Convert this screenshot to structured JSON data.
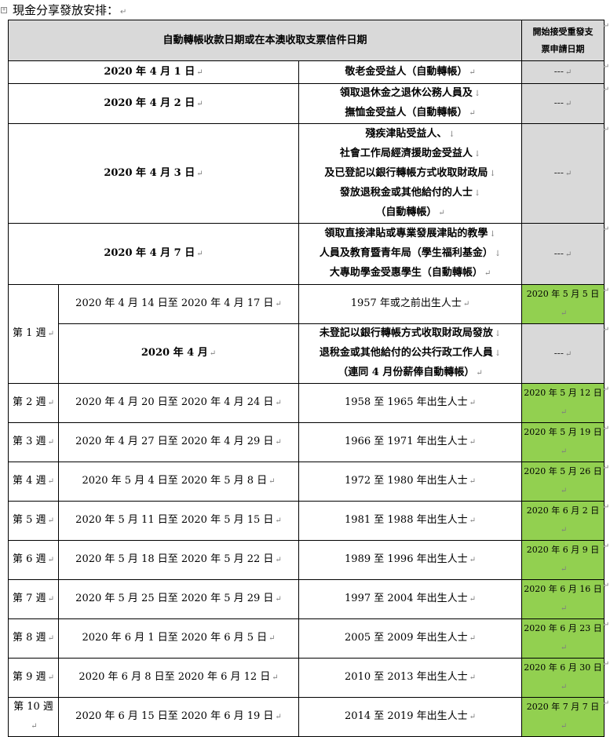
{
  "heading": "現金分享發放安排：",
  "header": {
    "main": "自動轉帳收款日期或在本澳收取支票信件日期",
    "right_line1": "開始接受重發支",
    "right_line2": "票申請日期"
  },
  "dash": "---",
  "rows": [
    {
      "date": "2020 年 4 月 1 日",
      "lines": [
        "敬老金受益人（自動轉帳）"
      ]
    },
    {
      "date": "2020 年 4 月 2 日",
      "lines": [
        "領取退休金之退休公務人員及",
        "撫恤金受益人（自動轉帳）"
      ]
    },
    {
      "date": "2020 年 4 月 3 日",
      "lines": [
        "殘疾津貼受益人、",
        "社會工作局經濟援助金受益人",
        "及已登記以銀行轉帳方式收取財政局",
        "發放退稅金或其他給付的人士",
        "（自動轉帳）"
      ]
    },
    {
      "date": "2020 年 4 月 7 日",
      "lines": [
        "領取直接津貼或專業發展津貼的教學",
        "人員及教育暨青年局（學生福利基金）",
        "大專助學金受惠學生（自動轉帳）"
      ]
    }
  ],
  "weeks": [
    {
      "week": "第 1 週",
      "period": "2020 年 4 月 14 日至  2020 年 4 月 17 日",
      "group": "1957 年或之前出生人士",
      "reissue": "2020 年 5 月 5 日",
      "extra": {
        "month": "2020 年 4 月",
        "lines": [
          "未登記以銀行轉帳方式收取財政局發放",
          "退稅金或其他給付的公共行政工作人員",
          "（連同 4 月份薪俸自動轉帳）"
        ]
      }
    },
    {
      "week": "第 2 週",
      "period": "2020 年 4 月 20 日至  2020 年 4 月 24 日",
      "group": "1958  至  1965 年出生人士",
      "reissue": "2020 年 5 月 12 日"
    },
    {
      "week": "第 3 週",
      "period": "2020 年 4 月 27 日至  2020 年 4 月 29 日",
      "group": "1966  至  1971 年出生人士",
      "reissue": "2020 年 5 月 19 日"
    },
    {
      "week": "第 4 週",
      "period": "2020 年 5 月 4 日至  2020 年 5 月 8 日",
      "group": "1972  至  1980 年出生人士",
      "reissue": "2020 年 5 月 26 日"
    },
    {
      "week": "第 5 週",
      "period": "2020 年 5 月 11 日至  2020 年 5 月 15 日",
      "group": "1981  至  1988 年出生人士",
      "reissue": "2020 年 6 月 2 日"
    },
    {
      "week": "第 6 週",
      "period": "2020 年 5 月 18 日至  2020 年 5 月 22 日",
      "group": "1989  至  1996 年出生人士",
      "reissue": "2020 年 6 月 9 日"
    },
    {
      "week": "第 7 週",
      "period": "2020 年 5 月 25 日至  2020 年 5 月 29 日",
      "group": "1997  至  2004 年出生人士",
      "reissue": "2020 年 6 月 16 日"
    },
    {
      "week": "第 8 週",
      "period": "2020 年 6 月 1 日至  2020 年 6 月 5 日",
      "group": "2005  至  2009 年出生人士",
      "reissue": "2020 年 6 月 23 日"
    },
    {
      "week": "第 9 週",
      "period": "2020 年 6 月 8 日至  2020 年 6 月 12 日",
      "group": "2010  至  2013 年出生人士",
      "reissue": "2020 年 6 月 30 日"
    },
    {
      "week": "第 10 週",
      "period": "2020 年 6 月 15 日至  2020 年 6 月 19 日",
      "group": "2014  至  2019 年出生人士",
      "reissue": "2020 年 7 月 7 日"
    }
  ],
  "colors": {
    "header_gray": "#d9d9d9",
    "reissue_green": "#92d050"
  },
  "icons": {
    "paragraph_mark": "↵",
    "line_break_mark": "↓",
    "table_anchor": "table-move-handle-icon"
  }
}
